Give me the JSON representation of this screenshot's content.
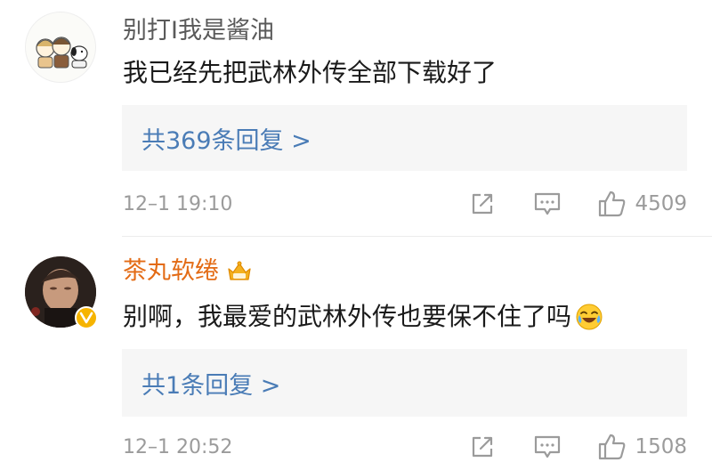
{
  "comments": [
    {
      "username": "别打I我是酱油",
      "text": "我已经先把武林外传全部下载好了",
      "reply_label": "共369条回复 >",
      "timestamp": "12–1 19:10",
      "likes": "4509",
      "icons": [
        "share-icon",
        "comment-icon",
        "like-icon"
      ]
    },
    {
      "username": "茶丸软绻",
      "text": "别啊，我最爱的武林外传也要保不住了吗",
      "emoji": "laugh-cry-emoji",
      "badge": "crown-member-icon",
      "verified": true,
      "reply_label": "共1条回复 >",
      "timestamp": "12–1 20:52",
      "likes": "1508",
      "icons": [
        "share-icon",
        "comment-icon",
        "like-icon"
      ]
    }
  ],
  "colors": {
    "link": "#4a7cb6",
    "vip_name": "#e36b15",
    "muted": "#9b9b9b",
    "reply_bg": "#f6f6f6",
    "verified": "#f6b400"
  }
}
